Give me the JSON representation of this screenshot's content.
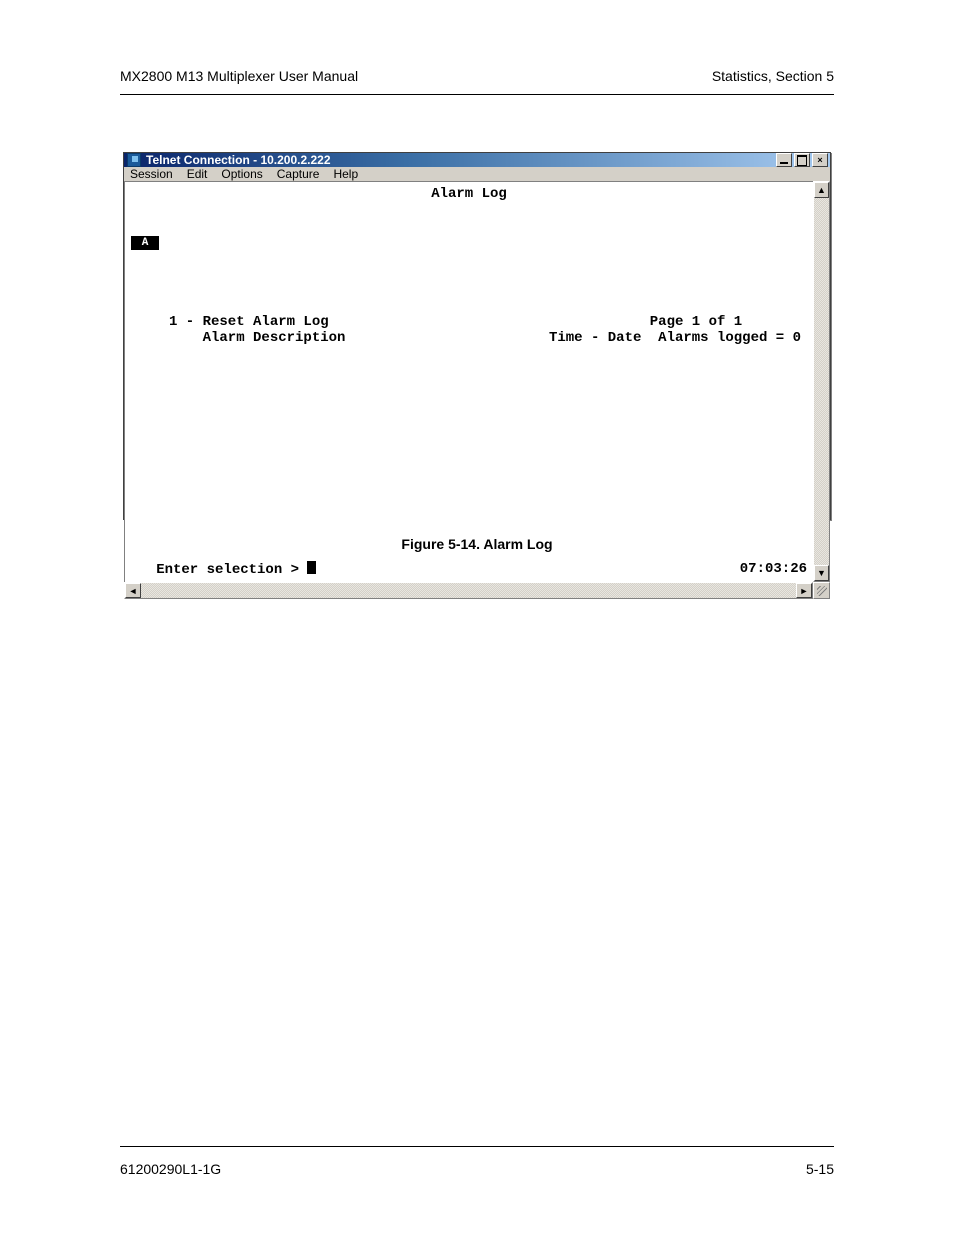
{
  "doc": {
    "header_left": "MX2800 M13 Multiplexer User Manual",
    "header_right": "Statistics, Section 5",
    "footer_left": "61200290L1-1G",
    "footer_right": "5-15",
    "figure_caption": "Figure 5-14.  Alarm Log"
  },
  "window": {
    "title": "Telnet Connection - 10.200.2.222",
    "menu": [
      "Session",
      "Edit",
      "Options",
      "Capture",
      "Help"
    ],
    "controls": {
      "close_glyph": "×"
    }
  },
  "terminal": {
    "badge": "A",
    "title": "Alarm Log",
    "left_lines": "1 - Reset Alarm Log\n    Alarm Description",
    "right_lines": "            Page 1 of 1\nTime - Date  Alarms logged = 0",
    "prompt_label": "   Enter selection > ",
    "clock": "07:03:26"
  }
}
